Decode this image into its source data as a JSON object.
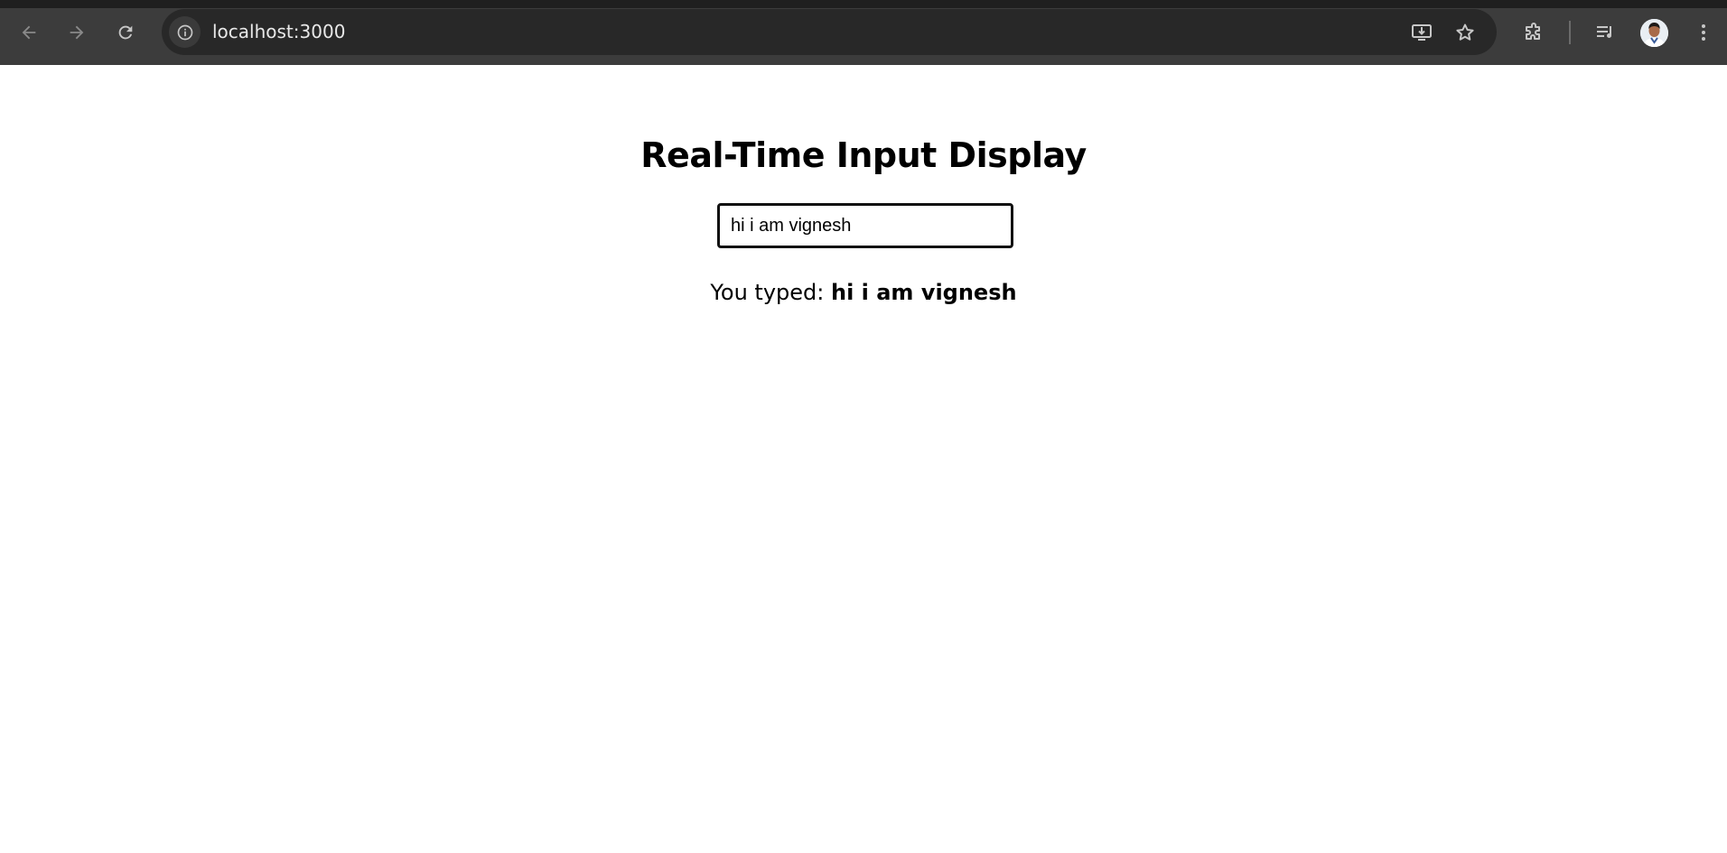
{
  "browser": {
    "url": "localhost:3000",
    "icons": {
      "back": "arrow-left-icon",
      "forward": "arrow-right-icon",
      "reload": "reload-icon",
      "site_info": "info-icon",
      "install": "install-app-icon",
      "bookmark": "star-icon",
      "extensions": "puzzle-icon",
      "media": "media-controls-icon",
      "profile": "avatar",
      "menu": "more-vert-icon"
    },
    "colors": {
      "toolbar": "#3c3c3c",
      "omnibox": "#282828",
      "icon": "#c7c7c7",
      "icon_disabled": "#8a8a8a"
    }
  },
  "page": {
    "title": "Real-Time Input Display",
    "input_value": "hi i am vignesh ",
    "typed_label": "You typed: ",
    "typed_value": "hi i am vignesh"
  }
}
